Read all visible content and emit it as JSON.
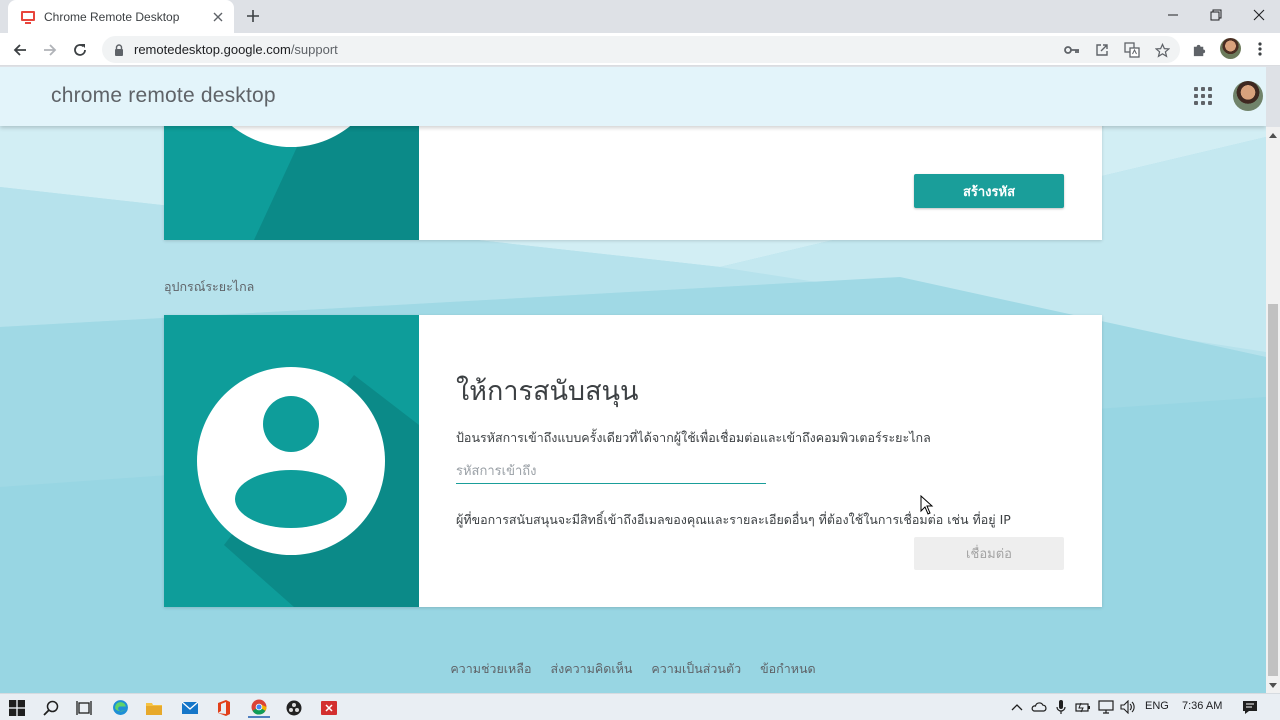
{
  "browser": {
    "tab_title": "Chrome Remote Desktop",
    "url_host": "remotedesktop.google.com",
    "url_path": "/support",
    "toolbar_icons": [
      "key-icon",
      "open-in-app-icon",
      "translate-icon",
      "bookmark-star-icon",
      "extensions-puzzle-icon",
      "profile-avatar",
      "kebab-menu-icon"
    ]
  },
  "app": {
    "title": "chrome remote desktop",
    "accent_color": "#1a9e9a"
  },
  "share_card": {
    "create_code_button": "สร้างรหัส"
  },
  "section_label": "อุปกรณ์ระยะไกล",
  "support_card": {
    "title": "ให้การสนับสนุน",
    "description": "ป้อนรหัสการเข้าถึงแบบครั้งเดียวที่ได้จากผู้ใช้เพื่อเชื่อมต่อและเข้าถึงคอมพิวเตอร์ระยะไกล",
    "code_placeholder": "รหัสการเข้าถึง",
    "note": "ผู้ที่ขอการสนับสนุนจะมีสิทธิ์เข้าถึงอีเมลของคุณและรายละเอียดอื่นๆ ที่ต้องใช้ในการเชื่อมต่อ เช่น ที่อยู่ IP",
    "connect_button": "เชื่อมต่อ"
  },
  "footer": {
    "links": [
      "ความช่วยเหลือ",
      "ส่งความคิดเห็น",
      "ความเป็นส่วนตัว",
      "ข้อกำหนด"
    ]
  },
  "taskbar": {
    "language": "ENG",
    "time": "7:36 AM"
  }
}
